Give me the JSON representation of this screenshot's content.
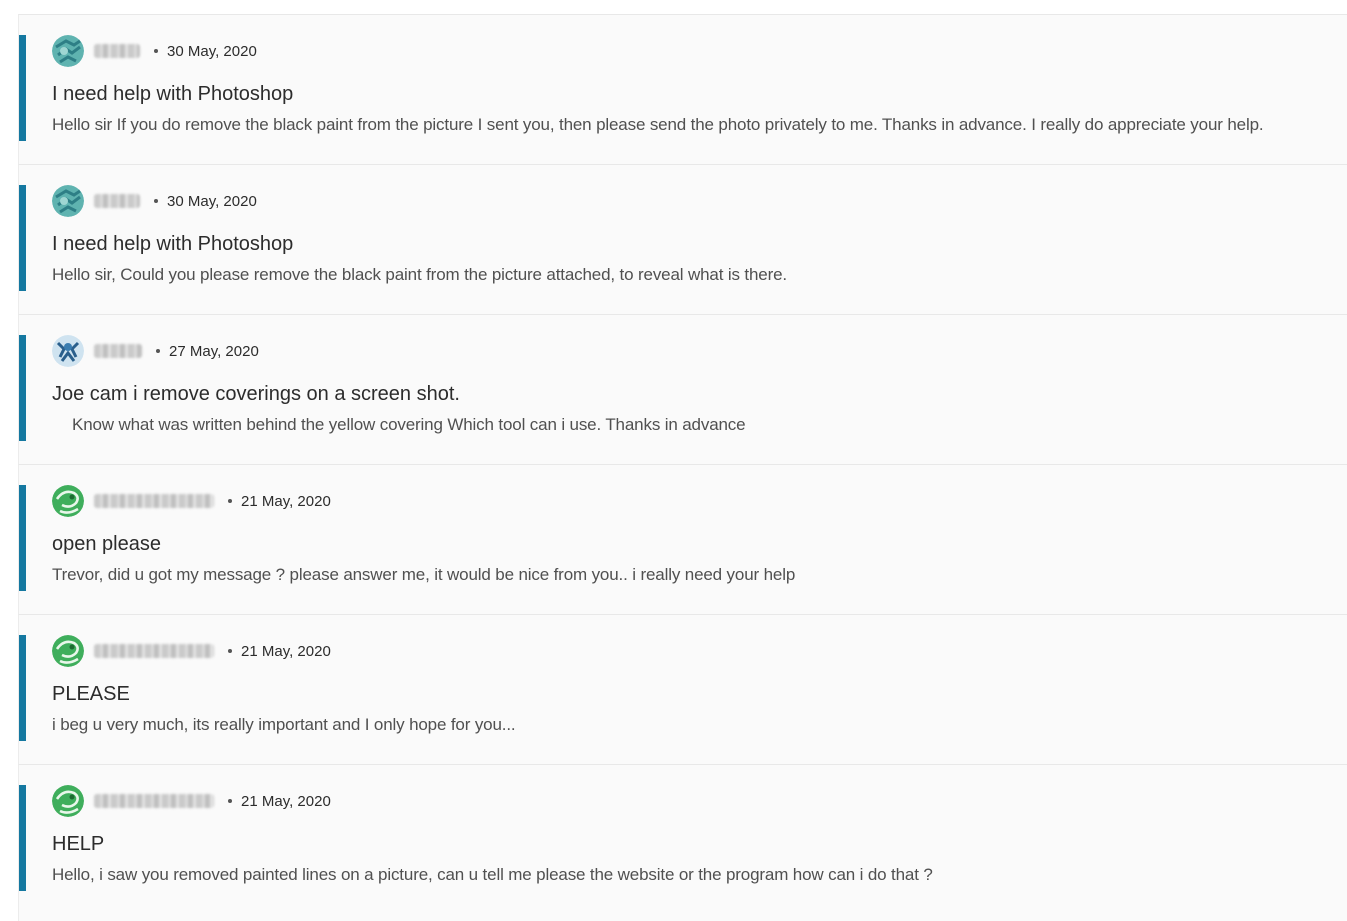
{
  "posts": [
    {
      "date": "30 May, 2020",
      "title": "I need help with Photoshop",
      "body": "Hello sir If you do remove the black paint from the picture I sent you, then please send the photo privately to me. Thanks in advance. I really do appreciate your help.",
      "avatar_icon": "teal-pattern-avatar"
    },
    {
      "date": "30 May, 2020",
      "title": "I need help with Photoshop",
      "body": "Hello sir,  Could you please remove the black paint from the picture attached, to reveal what is there.",
      "avatar_icon": "teal-pattern-avatar"
    },
    {
      "date": "27 May, 2020",
      "title": "Joe cam i remove coverings on a screen shot.",
      "body": "Know what was written behind the yellow covering  Which tool can i use. Thanks in advance",
      "avatar_icon": "blue-pattern-avatar"
    },
    {
      "date": "21 May, 2020",
      "title": "open please",
      "body": "Trevor, did u got my message ? please answer me, it would be nice from you.. i really need your help",
      "avatar_icon": "green-pattern-avatar"
    },
    {
      "date": "21 May, 2020",
      "title": "PLEASE",
      "body": "i beg u very much, its really important and I only hope for you...",
      "avatar_icon": "green-pattern-avatar"
    },
    {
      "date": "21 May, 2020",
      "title": "HELP",
      "body": "Hello, i saw you removed painted lines on a picture, can u tell me please the website or the program how can i do that ?",
      "avatar_icon": "green-pattern-avatar"
    }
  ],
  "colors": {
    "accent": "#1478a0",
    "card_bg": "#fafafa"
  }
}
